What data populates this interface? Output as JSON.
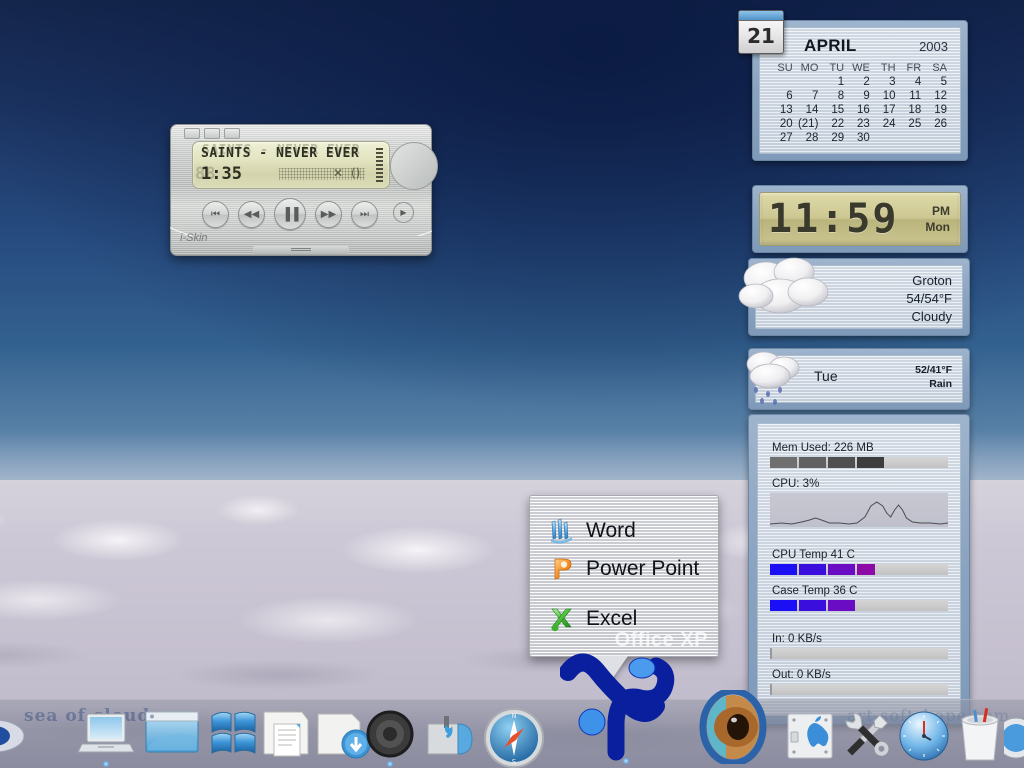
{
  "desktop": {
    "wallpaper_name": "sea-of-clouds",
    "watermark_left": "sea of clouds",
    "watermark_right": "art-softshape.com",
    "colors": {
      "sky_top": "#15264c",
      "sky_mid": "#33618f",
      "clouds": "#cdc9d4",
      "accent": "#6634c8"
    }
  },
  "calendar": {
    "tab_day": "21",
    "month": "APRIL",
    "year": "2003",
    "weekdays": [
      "SU",
      "MO",
      "TU",
      "WE",
      "TH",
      "FR",
      "SA"
    ],
    "weeks": [
      [
        "",
        "",
        "1",
        "2",
        "3",
        "4",
        "5"
      ],
      [
        "6",
        "7",
        "8",
        "9",
        "10",
        "11",
        "12"
      ],
      [
        "13",
        "14",
        "15",
        "16",
        "17",
        "18",
        "19"
      ],
      [
        "20",
        "(21)",
        "22",
        "23",
        "24",
        "25",
        "26"
      ],
      [
        "27",
        "28",
        "29",
        "30",
        "",
        "",
        ""
      ]
    ],
    "today": "(21)",
    "today_color": "#e02020",
    "saturday_color": "#6634c8"
  },
  "clock": {
    "time": "11:59",
    "meridiem": "PM",
    "weekday": "Mon"
  },
  "weather_now": {
    "location": "Groton",
    "temps": "54/54°F",
    "condition": "Cloudy",
    "icon": "cloudy-icon"
  },
  "weather_forecast": {
    "day": "Tue",
    "temps": "52/41°F",
    "condition": "Rain",
    "icon": "rain-icon"
  },
  "sysmon": {
    "mem_label": "Mem Used: 226 MB",
    "mem_segments": 4,
    "cpu_label": "CPU: 3%",
    "cpu_temp_label": "CPU Temp 41 C",
    "cpu_temp_segments": 4,
    "case_temp_label": "Case Temp 36 C",
    "case_temp_segments": 3,
    "net_in_label": "In: 0 KB/s",
    "net_out_label": "Out: 0 KB/s"
  },
  "player": {
    "track_title": "SAINTS - NEVER EVER",
    "time_elapsed": "1:35",
    "time_ghost": "88",
    "brand": "i-Skin",
    "controls": [
      {
        "name": "previous-track-button",
        "glyph": "⏮"
      },
      {
        "name": "rewind-button",
        "glyph": "◀◀"
      },
      {
        "name": "pause-button",
        "glyph": "▐▐"
      },
      {
        "name": "fast-forward-button",
        "glyph": "▶▶"
      },
      {
        "name": "next-track-button",
        "glyph": "⏭"
      }
    ],
    "extra_button_glyph": "▶",
    "lcd_glyph_x": "✕",
    "lcd_glyph_paren": "()"
  },
  "office_popup": {
    "watermark": "Office XP",
    "items": [
      {
        "label": "Word",
        "icon": "word-icon"
      },
      {
        "label": "Power Point",
        "icon": "powerpoint-icon"
      },
      {
        "label": "Excel",
        "icon": "excel-icon"
      }
    ]
  },
  "dock": {
    "items": [
      {
        "name": "dock-item-eye-left",
        "label": "eye-icon"
      },
      {
        "name": "dock-item-laptop",
        "label": "laptop-icon"
      },
      {
        "name": "dock-item-window",
        "label": "window-icon"
      },
      {
        "name": "dock-item-windows-flag",
        "label": "windows-flag-icon"
      },
      {
        "name": "dock-item-documents",
        "label": "documents-icon"
      },
      {
        "name": "dock-item-downloads",
        "label": "downloads-folder-icon"
      },
      {
        "name": "dock-item-speaker",
        "label": "speaker-icon"
      },
      {
        "name": "dock-item-mail",
        "label": "mailbox-icon"
      },
      {
        "name": "dock-item-safari",
        "label": "compass-browser-icon"
      },
      {
        "name": "dock-item-office-xp",
        "label": "office-xp-icon"
      },
      {
        "name": "dock-item-eye",
        "label": "eye-icon"
      },
      {
        "name": "dock-item-system-prefs",
        "label": "apple-system-icon"
      },
      {
        "name": "dock-item-tools",
        "label": "wrench-screwdriver-icon"
      },
      {
        "name": "dock-item-clock",
        "label": "clock-icon"
      },
      {
        "name": "dock-item-trash",
        "label": "trash-icon"
      },
      {
        "name": "dock-item-edge",
        "label": "sphere-icon"
      }
    ]
  }
}
